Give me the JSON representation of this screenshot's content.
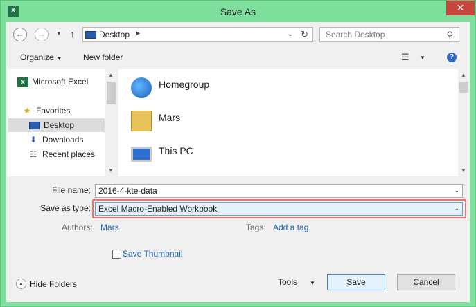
{
  "window": {
    "title": "Save As",
    "app_icon": "excel-icon",
    "close_label": "✕"
  },
  "address_bar": {
    "path": "Desktop",
    "search_placeholder": "Search Desktop"
  },
  "toolbar": {
    "organize_label": "Organize",
    "new_folder_label": "New folder"
  },
  "nav_pane": {
    "items": [
      {
        "label": "Microsoft Excel",
        "icon": "excel-icon"
      },
      {
        "label": "Favorites",
        "icon": "star-icon"
      },
      {
        "label": "Desktop",
        "icon": "desktop-icon",
        "selected": true
      },
      {
        "label": "Downloads",
        "icon": "downloads-icon"
      },
      {
        "label": "Recent places",
        "icon": "recent-places-icon"
      }
    ]
  },
  "file_pane": {
    "items": [
      {
        "label": "Homegroup",
        "icon": "homegroup-icon"
      },
      {
        "label": "Mars",
        "icon": "user-folder-icon"
      },
      {
        "label": "This PC",
        "icon": "computer-icon"
      }
    ]
  },
  "form": {
    "file_name_label": "File name:",
    "file_name_value": "2016-4-kte-data",
    "save_type_label": "Save as type:",
    "save_type_value": "Excel Macro-Enabled Workbook",
    "authors_label": "Authors:",
    "authors_value": "Mars",
    "tags_label": "Tags:",
    "tags_value": "Add a tag",
    "thumbnail_label": "Save Thumbnail"
  },
  "footer": {
    "hide_folders_label": "Hide Folders",
    "tools_label": "Tools",
    "save_label": "Save",
    "cancel_label": "Cancel"
  },
  "colors": {
    "frame": "#7fe09d",
    "close": "#c7463b",
    "highlight": "#e8746f",
    "link": "#1d63b8"
  }
}
